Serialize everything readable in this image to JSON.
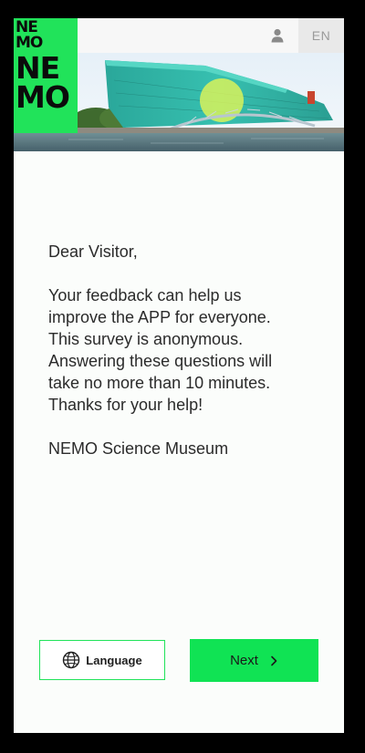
{
  "topbar": {
    "user_icon": "user-icon",
    "language_code": "EN"
  },
  "logo": {
    "rows": [
      "NE",
      "MO",
      "NE",
      "MO"
    ]
  },
  "intro": {
    "greeting": "Dear Visitor,",
    "body_lines": [
      "Your feedback can help us",
      "improve the APP for everyone.",
      "This survey is anonymous.",
      "Answering these questions will",
      "take no more than 10 minutes.",
      "Thanks for your help!"
    ],
    "signature": "NEMO Science Museum"
  },
  "buttons": {
    "language_label": "Language",
    "language_icon": "globe-icon",
    "next_label": "Next",
    "next_icon": "chevron-right-icon"
  },
  "colors": {
    "accent": "#21e35a",
    "next_bg": "#10e354",
    "text": "#2b2b2b"
  }
}
